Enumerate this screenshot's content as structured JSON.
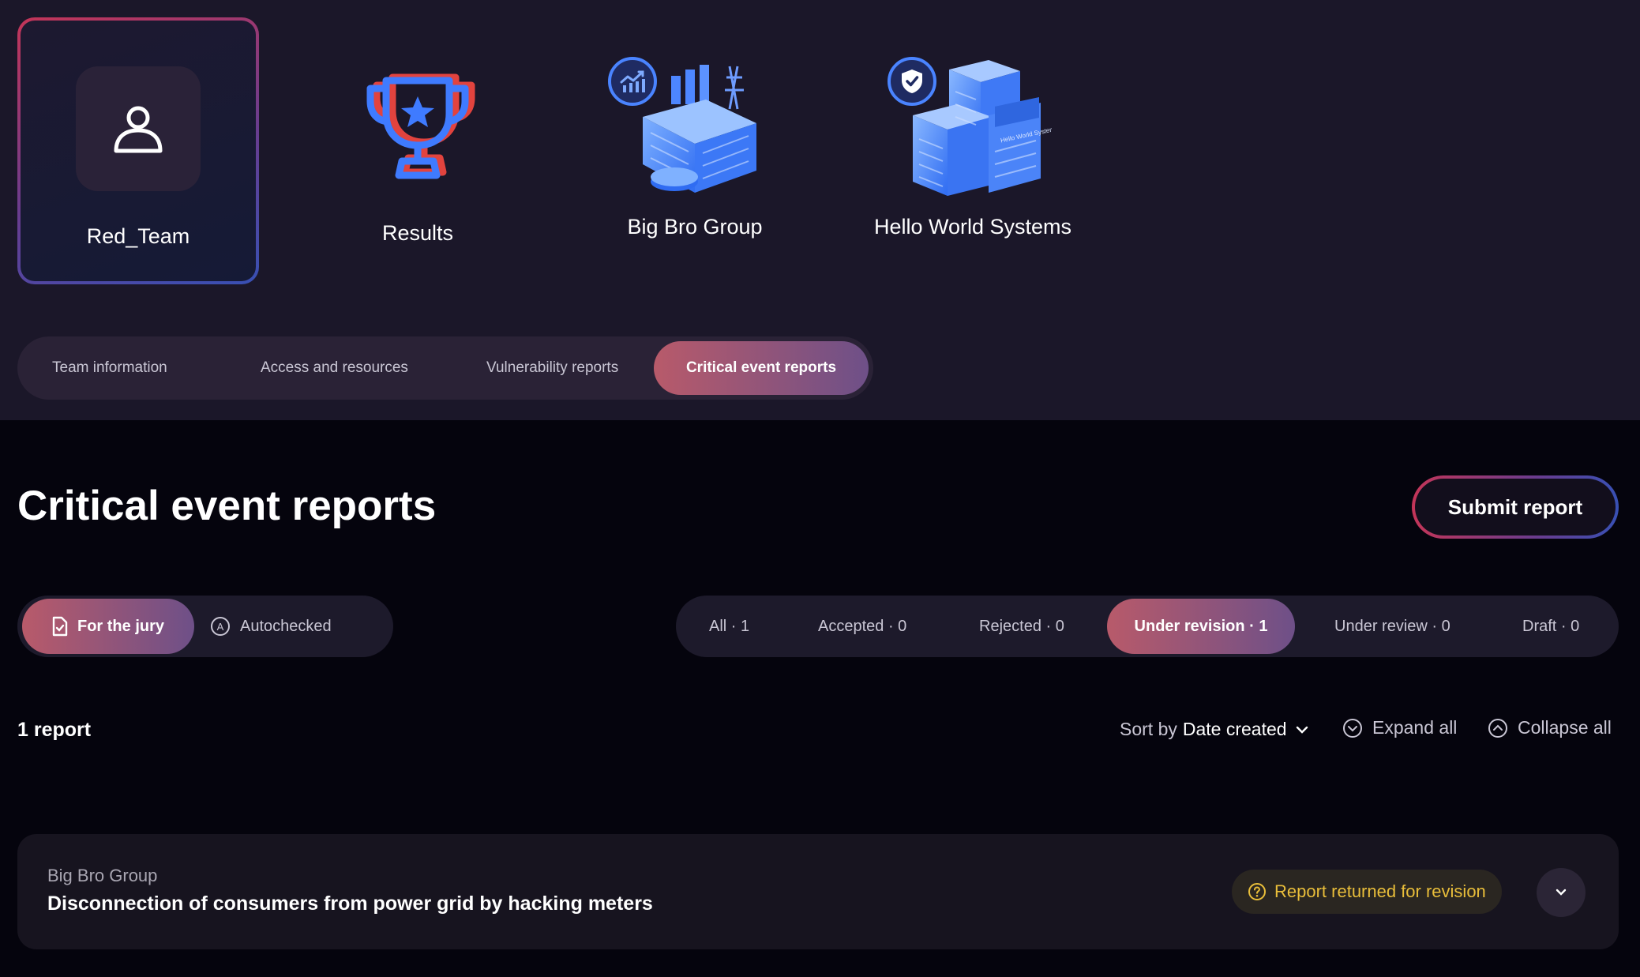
{
  "nav": {
    "team_label": "Red_Team",
    "results_label": "Results",
    "company1_label": "Big Bro Group",
    "company2_label": "Hello World Systems",
    "company2_sign": "Hello World Systems"
  },
  "tabs": [
    {
      "label": "Team information"
    },
    {
      "label": "Access and resources"
    },
    {
      "label": "Vulnerability reports"
    },
    {
      "label": "Critical event reports"
    }
  ],
  "page": {
    "title": "Critical event reports",
    "submit_label": "Submit report"
  },
  "source_filter": [
    {
      "label": "For the jury"
    },
    {
      "label": "Autochecked"
    }
  ],
  "status_filter": [
    {
      "label": "All · 1"
    },
    {
      "label": "Accepted · 0"
    },
    {
      "label": "Rejected · 0"
    },
    {
      "label": "Under revision · 1"
    },
    {
      "label": "Under review · 0"
    },
    {
      "label": "Draft · 0"
    }
  ],
  "list": {
    "count": "1 report",
    "sort_prefix": "Sort by",
    "sort_value": "Date created",
    "expand_all": "Expand all",
    "collapse_all": "Collapse all"
  },
  "reports": [
    {
      "company": "Big Bro Group",
      "title": "Disconnection of consumers from power grid by hacking meters",
      "status": "Report returned for revision"
    }
  ],
  "colors": {
    "accent_red": "#c43558",
    "accent_blue": "#3850b4",
    "status_yellow": "#e9be3a"
  }
}
